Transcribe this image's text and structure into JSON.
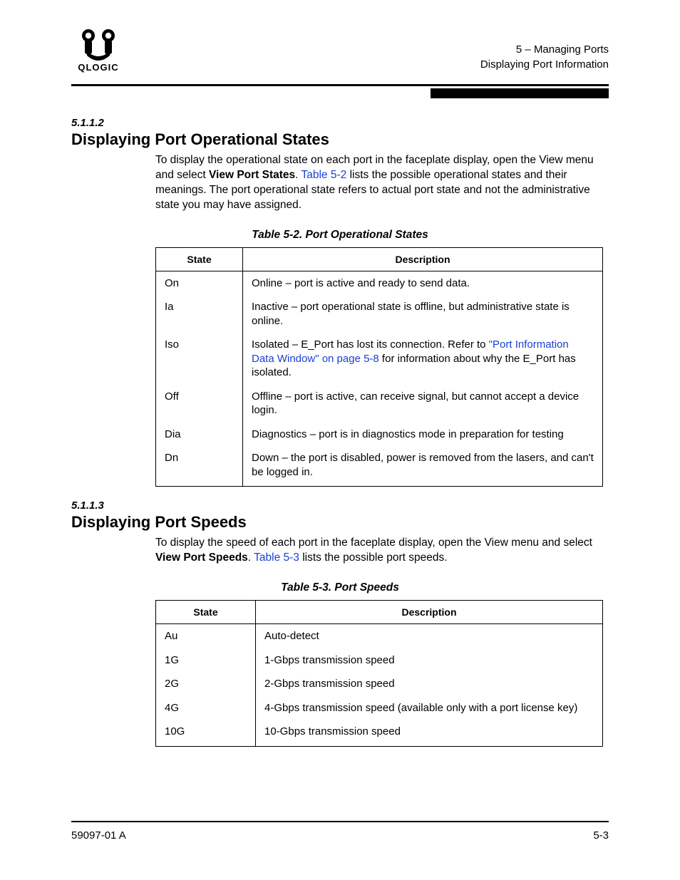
{
  "header": {
    "chapter": "5 – Managing Ports",
    "section": "Displaying Port Information",
    "logo_text": "QLOGIC"
  },
  "sec1": {
    "num": "5.1.1.2",
    "title": "Displaying Port Operational States",
    "para_pre": "To display the operational state on each port in the faceplate display, open the View menu and select ",
    "bold1": "View Port States",
    "mid1": ". ",
    "link1": "Table 5-2",
    "para_post": " lists the possible operational states and their meanings. The port operational state refers to actual port state and not the administrative state you may have assigned.",
    "table_caption": "Table 5-2. Port Operational States",
    "col1": "State",
    "col2": "Description",
    "rows": [
      {
        "state": "On",
        "desc_pre": "Online – port is active and ready to send data.",
        "link": "",
        "desc_post": ""
      },
      {
        "state": "Ia",
        "desc_pre": "Inactive – port operational state is offline, but administrative state is online.",
        "link": "",
        "desc_post": ""
      },
      {
        "state": "Iso",
        "desc_pre": "Isolated – E_Port has lost its connection. Refer to ",
        "link": "\"Port Information Data Window\" on page 5-8",
        "desc_post": " for information about why the E_Port has isolated."
      },
      {
        "state": "Off",
        "desc_pre": "Offline – port is active, can receive signal, but cannot accept a device login.",
        "link": "",
        "desc_post": ""
      },
      {
        "state": "Dia",
        "desc_pre": "Diagnostics – port is in diagnostics mode in preparation for testing",
        "link": "",
        "desc_post": ""
      },
      {
        "state": "Dn",
        "desc_pre": "Down – the port is disabled, power is removed from the lasers, and can't be logged in.",
        "link": "",
        "desc_post": ""
      }
    ]
  },
  "sec2": {
    "num": "5.1.1.3",
    "title": "Displaying Port Speeds",
    "para_pre": "To display the speed of each port in the faceplate display, open the View menu and select ",
    "bold1": "View Port Speeds",
    "mid1": ". ",
    "link1": "Table 5-3",
    "para_post": " lists the possible port speeds.",
    "table_caption": "Table 5-3. Port Speeds",
    "col1": "State",
    "col2": "Description",
    "rows": [
      {
        "state": "Au",
        "desc": "Auto-detect"
      },
      {
        "state": "1G",
        "desc": "1-Gbps transmission speed"
      },
      {
        "state": "2G",
        "desc": "2-Gbps transmission speed"
      },
      {
        "state": "4G",
        "desc": "4-Gbps transmission speed (available only with a port license key)"
      },
      {
        "state": "10G",
        "desc": "10-Gbps transmission speed"
      }
    ]
  },
  "footer": {
    "left": "59097-01 A",
    "right": "5-3"
  }
}
